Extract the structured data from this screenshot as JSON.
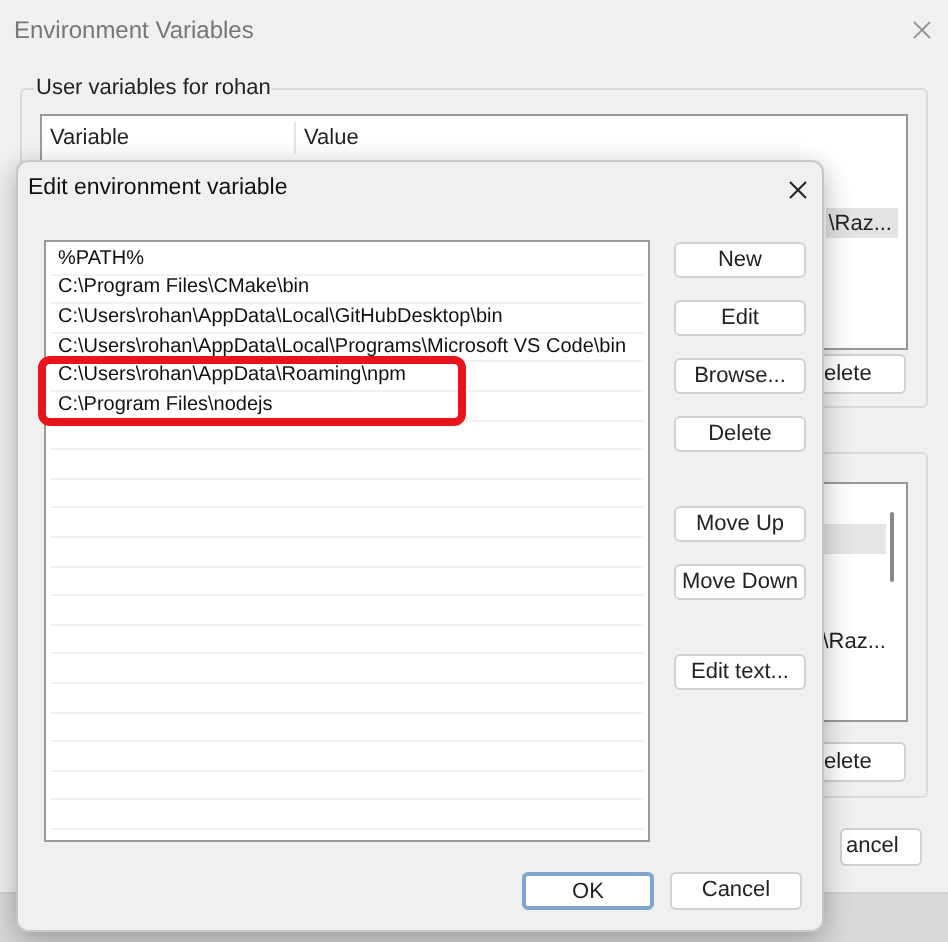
{
  "background_window": {
    "title": "Environment Variables",
    "group_label": "User variables for rohan",
    "columns": [
      "Variable",
      "Value"
    ],
    "user_values": [
      {
        "text": "\\Raz...",
        "selected": true
      }
    ],
    "user_buttons": [
      "elete"
    ],
    "system_list": {
      "has_selection": true,
      "values": [
        "\\Raz..."
      ]
    },
    "system_buttons": [
      "elete"
    ],
    "footer_buttons": [
      "ancel"
    ]
  },
  "dialog": {
    "title": "Edit environment variable",
    "entries": [
      {
        "text": "%PATH%",
        "highlighted": false
      },
      {
        "text": "C:\\Program Files\\CMake\\bin",
        "highlighted": false
      },
      {
        "text": "C:\\Users\\rohan\\AppData\\Local\\GitHubDesktop\\bin",
        "highlighted": false
      },
      {
        "text": "C:\\Users\\rohan\\AppData\\Local\\Programs\\Microsoft VS Code\\bin",
        "highlighted": false
      },
      {
        "text": "C:\\Users\\rohan\\AppData\\Roaming\\npm",
        "highlighted": true
      },
      {
        "text": "C:\\Program Files\\nodejs",
        "highlighted": true
      }
    ],
    "button_groups": [
      [
        "New",
        "Edit",
        "Browse...",
        "Delete"
      ],
      [
        "Move Up",
        "Move Down"
      ],
      [
        "Edit text..."
      ]
    ],
    "footer_buttons": [
      {
        "label": "OK",
        "default": true
      },
      {
        "label": "Cancel",
        "default": false
      }
    ]
  }
}
